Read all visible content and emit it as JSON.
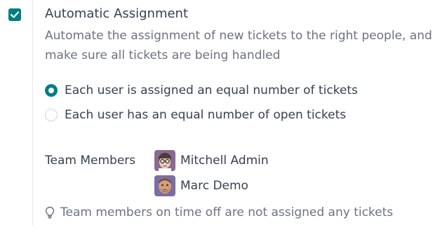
{
  "setting": {
    "title": "Automatic Assignment",
    "description": "Automate the assignment of new tickets to the right people, and make sure all tickets are being handled",
    "checked": true
  },
  "assignment_options": [
    {
      "label": "Each user is assigned an equal number of tickets",
      "selected": true
    },
    {
      "label": "Each user has an equal number of open tickets",
      "selected": false
    }
  ],
  "team": {
    "label": "Team Members",
    "members": [
      {
        "name": "Mitchell Admin",
        "avatar_icon": "mitchell-avatar"
      },
      {
        "name": "Marc Demo",
        "avatar_icon": "marc-avatar"
      }
    ]
  },
  "hint": {
    "icon": "lightbulb-icon",
    "text": "Team members on time off are not assigned any tickets"
  },
  "colors": {
    "accent": "#017e84",
    "text": "#374151",
    "muted": "#6b7280"
  }
}
